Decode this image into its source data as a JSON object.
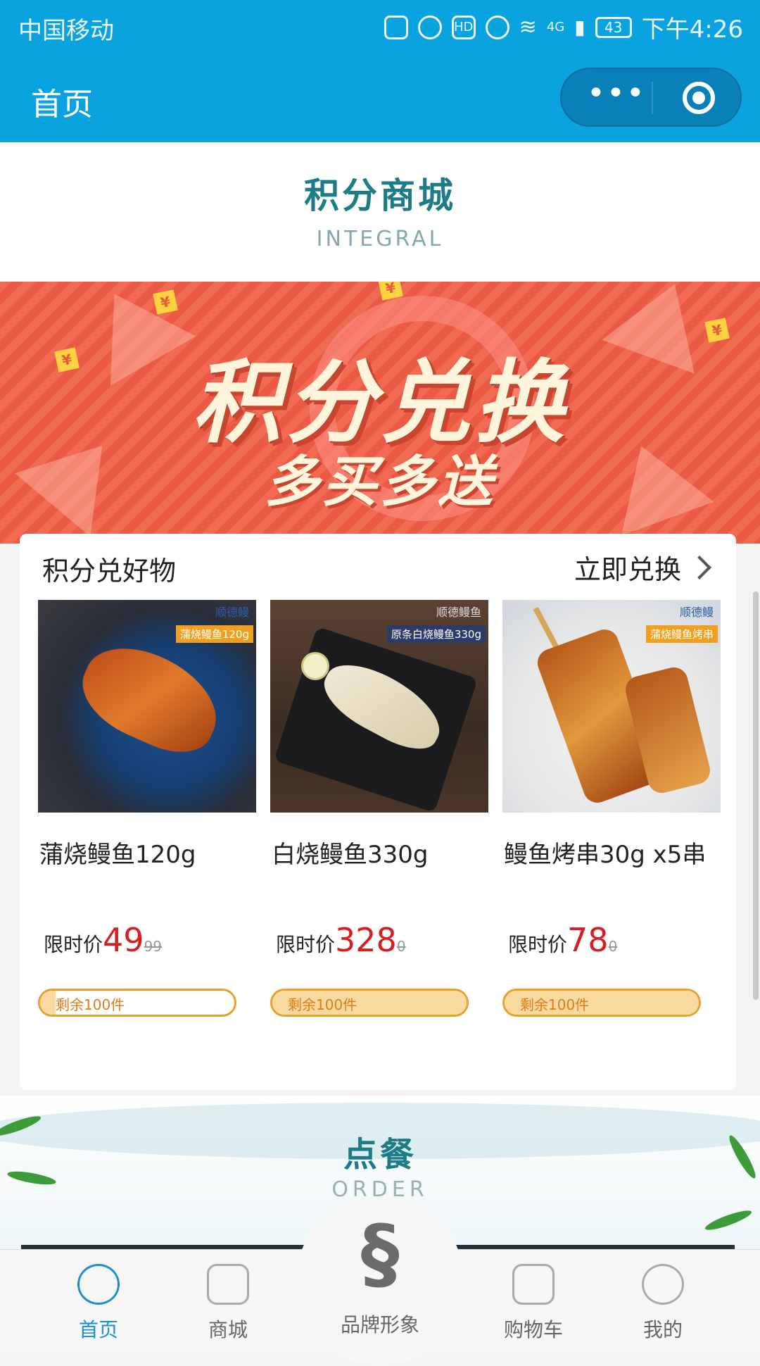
{
  "status_bar": {
    "carrier": "中国移动",
    "network": "4G",
    "battery": "43",
    "time": "下午4:26"
  },
  "nav": {
    "title": "首页",
    "more_icon": "more-dots-icon",
    "close_icon": "target-circle-icon"
  },
  "integral_section": {
    "title_cn": "积分商城",
    "title_en": "INTEGRAL"
  },
  "banner": {
    "headline": "积分兑换",
    "subline": "多买多送",
    "coin_symbol": "¥"
  },
  "exchange_card": {
    "title": "积分兑好物",
    "action": "立即兑换",
    "price_label": "限时价",
    "products": [
      {
        "name": "蒲烧鳗鱼120g",
        "price": "49",
        "original_price": "99",
        "stock_text": "剩余100件",
        "image_tag": "蒲烧鳗鱼120g",
        "image_brand": "顺德鳗",
        "stock_fill": 0.08
      },
      {
        "name": "白烧鳗鱼330g",
        "price": "328",
        "original_price": "0",
        "stock_text": "剩余100件",
        "image_tag": "原条白烧鳗鱼330g",
        "image_brand": "顺德鳗鱼",
        "stock_fill": 1.0
      },
      {
        "name": "鳗鱼烤串30g x5串",
        "price": "78",
        "original_price": "0",
        "stock_text": "剩余100件",
        "image_tag": "蒲烧鳗鱼烤串",
        "image_brand": "顺德鳗",
        "stock_fill": 1.0
      }
    ]
  },
  "order_section": {
    "title_cn": "点餐",
    "title_en": "ORDER"
  },
  "tab_bar": {
    "items": [
      {
        "label": "首页",
        "icon": "home-fish-icon",
        "active": true
      },
      {
        "label": "商城",
        "icon": "shop-icon",
        "active": false
      },
      {
        "label": "品牌形象",
        "icon": "brand-logo-icon",
        "active": false
      },
      {
        "label": "购物车",
        "icon": "cart-icon",
        "active": false
      },
      {
        "label": "我的",
        "icon": "profile-icon",
        "active": false
      }
    ]
  },
  "colors": {
    "primary": "#0aa3df",
    "accent_teal": "#1c7d86",
    "price_red": "#d81e1e",
    "stock_orange": "#e8a22a"
  }
}
